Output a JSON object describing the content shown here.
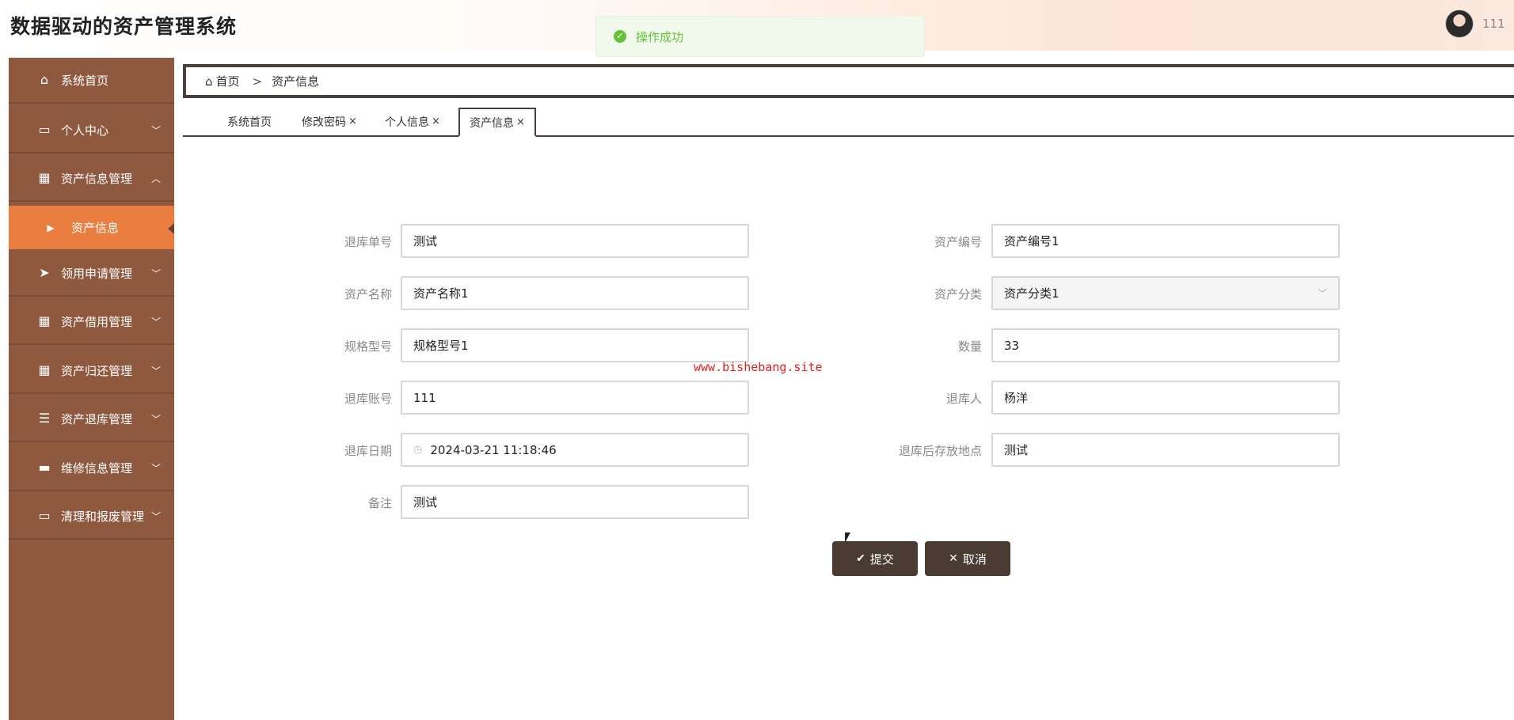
{
  "header": {
    "title": "数据驱动的资产管理系统",
    "username": "111"
  },
  "toast": {
    "message": "操作成功"
  },
  "sidebar": {
    "items": [
      {
        "label": "系统首页",
        "icon": "home-icon"
      },
      {
        "label": "个人中心",
        "icon": "card-icon"
      },
      {
        "label": "资产信息管理",
        "icon": "grid-icon"
      },
      {
        "label": "资产信息",
        "icon": "caret-right-icon"
      },
      {
        "label": "领用申请管理",
        "icon": "send-icon"
      },
      {
        "label": "资产借用管理",
        "icon": "grid-icon"
      },
      {
        "label": "资产归还管理",
        "icon": "grid-icon"
      },
      {
        "label": "资产退库管理",
        "icon": "list-icon"
      },
      {
        "label": "维修信息管理",
        "icon": "printer-icon"
      },
      {
        "label": "清理和报废管理",
        "icon": "monitor-icon"
      }
    ]
  },
  "breadcrumb": {
    "home": "首页",
    "separator": ">",
    "current": "资产信息"
  },
  "tabs": [
    {
      "label": "系统首页",
      "closable": false
    },
    {
      "label": "修改密码",
      "closable": true
    },
    {
      "label": "个人信息",
      "closable": true
    },
    {
      "label": "资产信息",
      "closable": true
    }
  ],
  "form": {
    "return_no": {
      "label": "退库单号",
      "value": "测试"
    },
    "asset_no": {
      "label": "资产编号",
      "value": "资产编号1"
    },
    "asset_name": {
      "label": "资产名称",
      "value": "资产名称1"
    },
    "asset_category": {
      "label": "资产分类",
      "value": "资产分类1"
    },
    "spec_model": {
      "label": "规格型号",
      "value": "规格型号1"
    },
    "quantity": {
      "label": "数量",
      "value": "33"
    },
    "return_account": {
      "label": "退库账号",
      "value": "111"
    },
    "return_person": {
      "label": "退库人",
      "value": "杨洋"
    },
    "return_date": {
      "label": "退库日期",
      "value": "2024-03-21 11:18:46"
    },
    "storage_location": {
      "label": "退库后存放地点",
      "value": "测试"
    },
    "remark": {
      "label": "备注",
      "value": "测试"
    }
  },
  "watermark": "www.bishebang.site",
  "buttons": {
    "submit": "提交",
    "cancel": "取消"
  },
  "colors": {
    "sidebar_bg": "#8f5940",
    "sidebar_active": "#e97e40",
    "button_bg": "#4a3b33",
    "success": "#67c23a"
  }
}
